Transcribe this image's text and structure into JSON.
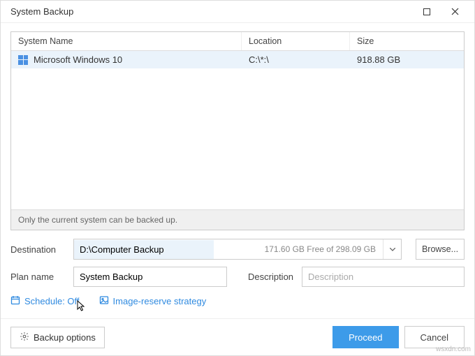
{
  "window": {
    "title": "System Backup"
  },
  "grid": {
    "headers": {
      "name": "System Name",
      "location": "Location",
      "size": "Size"
    },
    "row": {
      "name": "Microsoft Windows 10",
      "location": "C:\\*:\\",
      "size": "918.88 GB"
    },
    "footer": "Only the current system can be backed up."
  },
  "form": {
    "dest_label": "Destination",
    "dest_value": "D:\\Computer Backup",
    "dest_free": "171.60 GB Free of 298.09 GB",
    "browse": "Browse...",
    "plan_label": "Plan name",
    "plan_value": "System Backup",
    "desc_label": "Description",
    "desc_placeholder": "Description"
  },
  "links": {
    "schedule": "Schedule: Off",
    "strategy": "Image-reserve strategy"
  },
  "buttons": {
    "backup_options": "Backup options",
    "proceed": "Proceed",
    "cancel": "Cancel"
  },
  "watermark": "wsxdn.com"
}
